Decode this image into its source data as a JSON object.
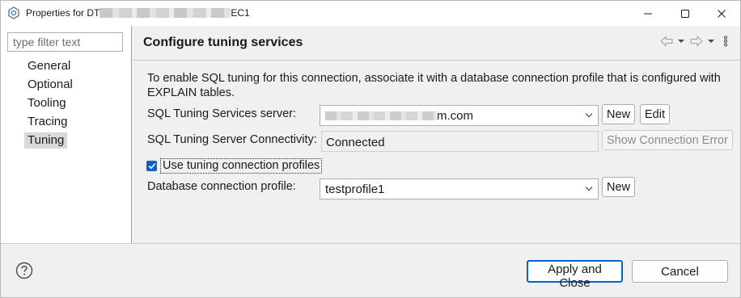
{
  "window": {
    "title_prefix": "Properties for DT",
    "title_suffix": "EC1",
    "accent_color": "#0a62c6"
  },
  "sidebar": {
    "filter_placeholder": "type filter text",
    "items": [
      {
        "label": "General"
      },
      {
        "label": "Optional"
      },
      {
        "label": "Tooling"
      },
      {
        "label": "Tracing"
      },
      {
        "label": "Tuning",
        "selected": true
      }
    ]
  },
  "page": {
    "title": "Configure tuning services",
    "description": "To enable SQL tuning for this connection, associate it with a database connection profile that is configured with EXPLAIN tables.",
    "server_label": "SQL Tuning Services server:",
    "server_value_suffix": "m.com",
    "connectivity_label": "SQL Tuning Server Connectivity:",
    "connectivity_value": "Connected",
    "new_label": "New",
    "edit_label": "Edit",
    "show_error_label": "Show Connection Error",
    "use_profiles_label": "Use tuning connection profiles",
    "use_profiles_checked": true,
    "profile_label": "Database connection profile:",
    "profile_value": "testprofile1",
    "profile_new_label": "New"
  },
  "footer": {
    "apply_label": "Apply and Close",
    "cancel_label": "Cancel"
  },
  "icons": [
    "app-icon",
    "minimize-icon",
    "maximize-icon",
    "close-icon",
    "back-arrow-icon",
    "forward-arrow-icon",
    "dropdown-icon",
    "view-menu-icon",
    "chevron-down-icon",
    "check-icon",
    "help-icon"
  ]
}
